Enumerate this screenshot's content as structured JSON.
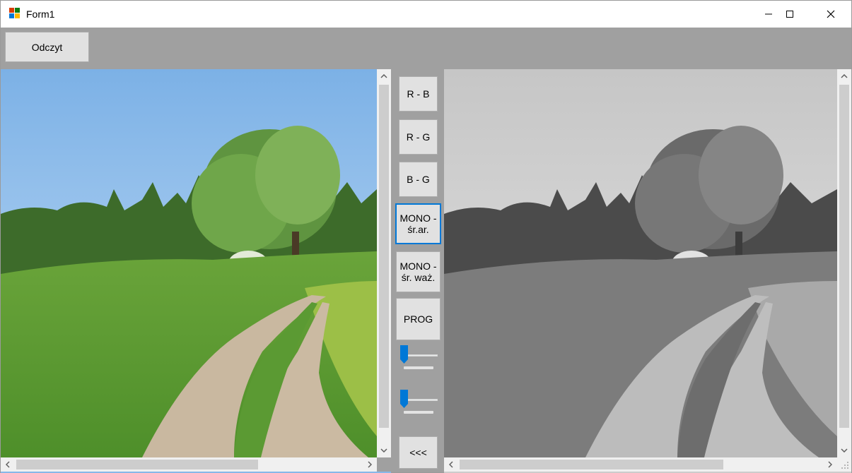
{
  "window": {
    "title": "Form1",
    "controls": {
      "minimize": "minimize-icon",
      "maximize": "maximize-icon",
      "close": "close-icon"
    }
  },
  "toolbar": {
    "load_label": "Odczyt"
  },
  "buttons": {
    "r_b": "R - B",
    "r_g": "R - G",
    "b_g": "B - G",
    "mono_avg_line1": "MONO -",
    "mono_avg_line2": "śr.ar.",
    "mono_weighted_line1": "MONO -",
    "mono_weighted_line2": "śr. waż.",
    "threshold": "PROG",
    "copy_back": "<<<"
  },
  "sliders": {
    "slider_1": {
      "min": 0,
      "max": 10,
      "value": 0
    },
    "slider_2": {
      "min": 0,
      "max": 10,
      "value": 0
    }
  },
  "images": {
    "left": "color landscape photo",
    "right": "grayscale landscape photo"
  },
  "scrollbars": {
    "left_h_position": 0.0,
    "right_h_position": 0.0
  },
  "colors": {
    "accent": "#0078d7",
    "button_face": "#e1e1e1",
    "form_background": "#a0a0a0"
  }
}
